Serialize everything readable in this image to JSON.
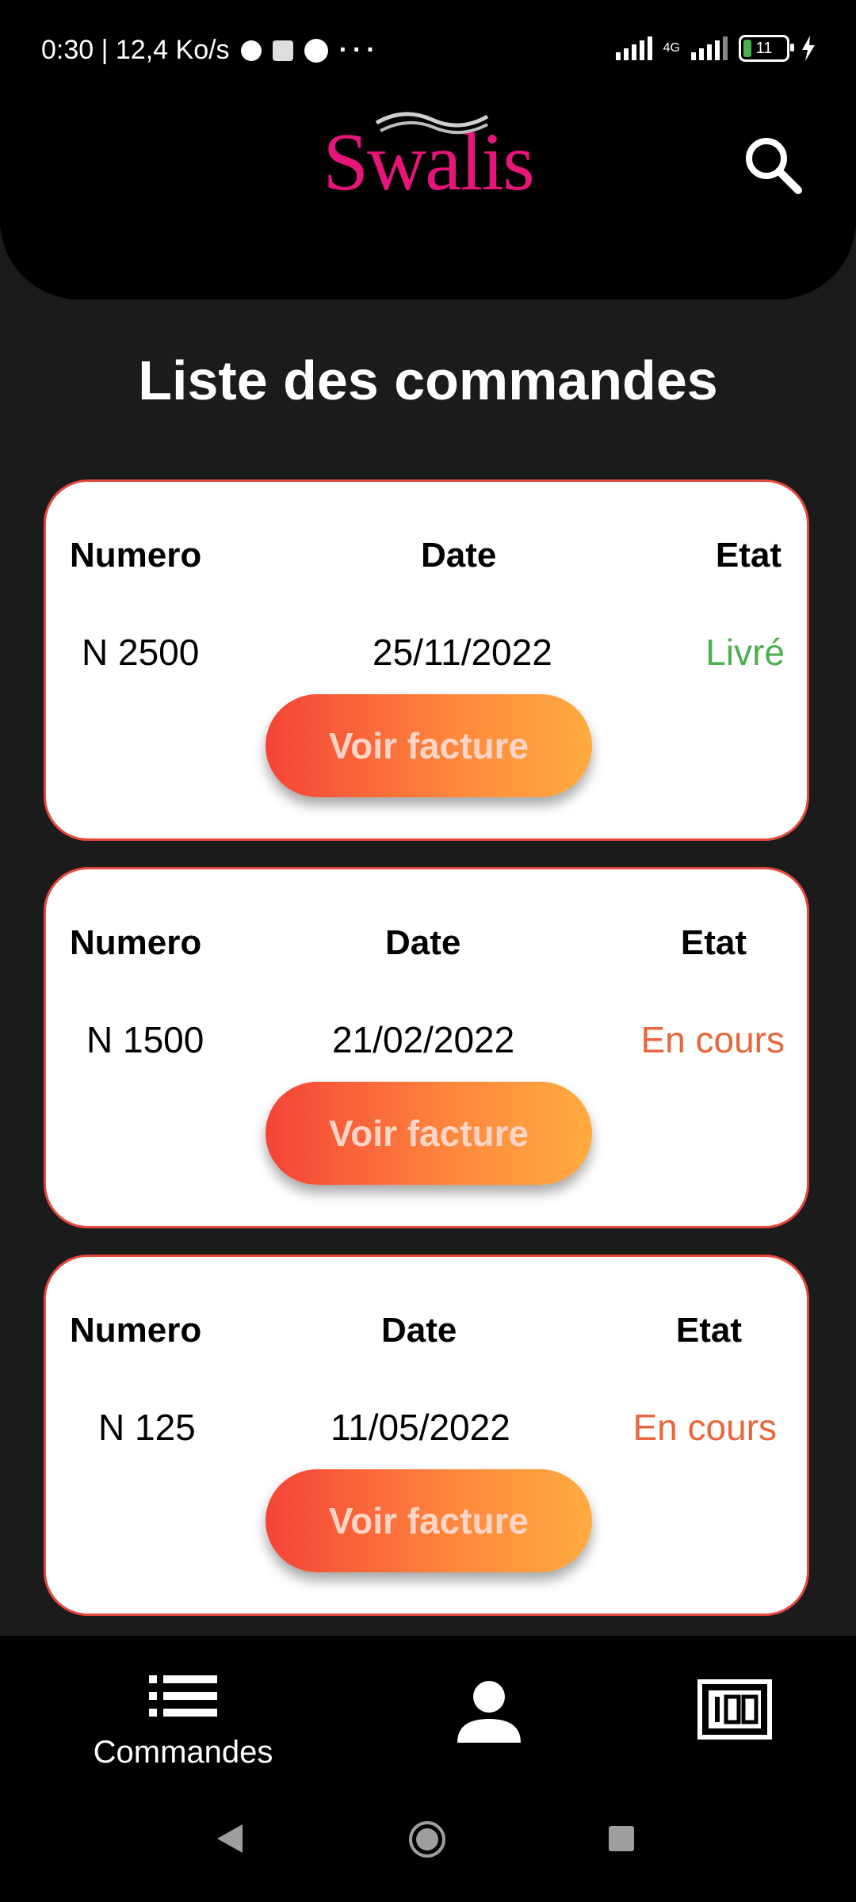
{
  "status_bar": {
    "time_speed": "0:30 | 12,4 Ko/s",
    "more": "···",
    "network": "4G",
    "battery": "11"
  },
  "header": {
    "logo_text": "Swalis",
    "logo_color": "#e6157a"
  },
  "page": {
    "title": "Liste des commandes"
  },
  "orders": [
    {
      "col_number": "Numero",
      "col_date": "Date",
      "col_state": "Etat",
      "number": "N 2500",
      "date": "25/11/2022",
      "state": "Livré",
      "state_color": "#4caf50",
      "button_label": "Voir facture"
    },
    {
      "col_number": "Numero",
      "col_date": "Date",
      "col_state": "Etat",
      "number": "N 1500",
      "date": "21/02/2022",
      "state": "En cours",
      "state_color": "#e8663c",
      "button_label": "Voir facture"
    },
    {
      "col_number": "Numero",
      "col_date": "Date",
      "col_state": "Etat",
      "number": "N 125",
      "date": "11/05/2022",
      "state": "En cours",
      "state_color": "#e8663c",
      "button_label": "Voir facture"
    }
  ],
  "bottom_nav": {
    "commandes_label": "Commandes",
    "icons": [
      "list-icon",
      "person-icon",
      "counter-icon"
    ]
  },
  "colors": {
    "accent_gradient_start": "#f44336",
    "accent_gradient_end": "#ffab40",
    "card_border": "#e4483d",
    "background": "#1b1b1b"
  }
}
